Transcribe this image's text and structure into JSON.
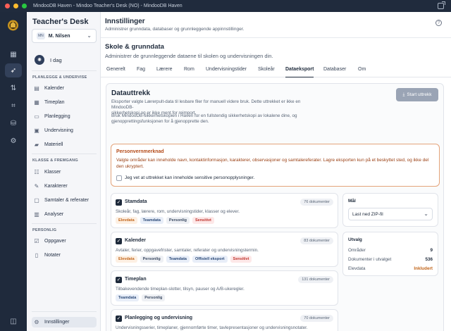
{
  "window": {
    "title": "MindooDB Haven - Mindoo Teacher's Desk (NO) - MindooDB Haven"
  },
  "sidebar": {
    "brand": "Teacher's Desk",
    "user_initials": "MN",
    "user_name": "M. Nilsen",
    "today": "I dag",
    "sections": [
      {
        "heading": "PLANLEGGE & UNDERVISE",
        "items": [
          "Kalender",
          "Timeplan",
          "Planlegging",
          "Undervisning",
          "Materiell"
        ]
      },
      {
        "heading": "KLASSE & FREMGANG",
        "items": [
          "Klasser",
          "Karakterer",
          "Samtaler & referater",
          "Analyser"
        ]
      },
      {
        "heading": "PERSONLIG",
        "items": [
          "Oppgaver",
          "Notater"
        ]
      }
    ],
    "settings": "Innstillinger"
  },
  "header": {
    "title": "Innstillinger",
    "subtitle": "Administrer grunndata, databaser og grunnleggende appinnstillinger."
  },
  "section": {
    "title": "Skole & grunndata",
    "subtitle": "Administrer de grunnleggende dataene til skolen og undervisningen din."
  },
  "tabs": [
    "Generelt",
    "Fag",
    "Lærere",
    "Rom",
    "Undervisningstider",
    "Skoleår",
    "Dataeksport",
    "Databaser",
    "Om"
  ],
  "active_tab": "Dataeksport",
  "export": {
    "title": "Datauttrekk",
    "button": "Start uttrekk",
    "desc1_l1": "Eksporter valgte Lærerpult-data til lesbare filer for manuell videre bruk. Dette uttrekket er ikke en MindooDB-",
    "desc1_l2": "sikkerhetskopi og er ikke ment for reimport.",
    "desc2_l1": "Bruk MindooDB-sikkerhetskopien i Haven for en fullstendig sikkerhetskopi av lokalene dine, og",
    "desc2_l2": "gjenopprettingsfunksjonen for å gjenopprette den."
  },
  "warning": {
    "title": "Personvernmerknad",
    "text": "Valgte områder kan inneholde navn, kontaktinformasjon, karakterer, observasjoner og samtalereferater. Lagre eksporten kun på et beskyttet sted, og ikke del den ukryptert.",
    "confirm": "Jeg vet at uttrekket kan inneholde sensitive personopplysninger."
  },
  "items": [
    {
      "title": "Stamdata",
      "count": "76 dokumenter",
      "desc": "Skoleår, fag, lærere, rom, undervisningstider, klasser og elever.",
      "tags": [
        "Elevdata",
        "Teamdata",
        "Personlig",
        "Sensitivt"
      ]
    },
    {
      "title": "Kalender",
      "count": "83 dokumenter",
      "desc": "Avtaler, ferier, oppgavefrister, samtaler, referater og undervisningstermin.",
      "tags": [
        "Elevdata",
        "Personlig",
        "Teamdata",
        "Offisiell eksport",
        "Sensitivt"
      ]
    },
    {
      "title": "Timeplan",
      "count": "131 dokumenter",
      "desc": "Tilbakevendende timeplan-slotter, tilsyn, pauser og A/B-ukeregler.",
      "tags": [
        "Teamdata",
        "Personlig"
      ]
    },
    {
      "title": "Planlegging og undervisning",
      "count": "70 dokumenter",
      "desc": "Undervisningsserier, timeplaner, gjennomførte timer, tavlepresentasjoner og undervisningsnotater.",
      "tags": []
    }
  ],
  "tag_colors": {
    "Elevdata": [
      "#fdf0e3",
      "#c2661c"
    ],
    "Teamdata": [
      "#e8eef8",
      "#2c4a78"
    ],
    "Personlig": [
      "#eef0f4",
      "#3b4a62"
    ],
    "Sensitivt": [
      "#fde8e8",
      "#c0352f"
    ],
    "Offisiell eksport": [
      "#e8eef8",
      "#2c4a78"
    ]
  },
  "goal": {
    "title": "Mål",
    "value": "Last ned ZIP-fil"
  },
  "selection": {
    "title": "Utvalg",
    "rows": [
      {
        "label": "Områder",
        "value": "9"
      },
      {
        "label": "Dokumenter i utvalget",
        "value": "536"
      },
      {
        "label": "Elevdata",
        "value": "Inkludert"
      }
    ]
  }
}
